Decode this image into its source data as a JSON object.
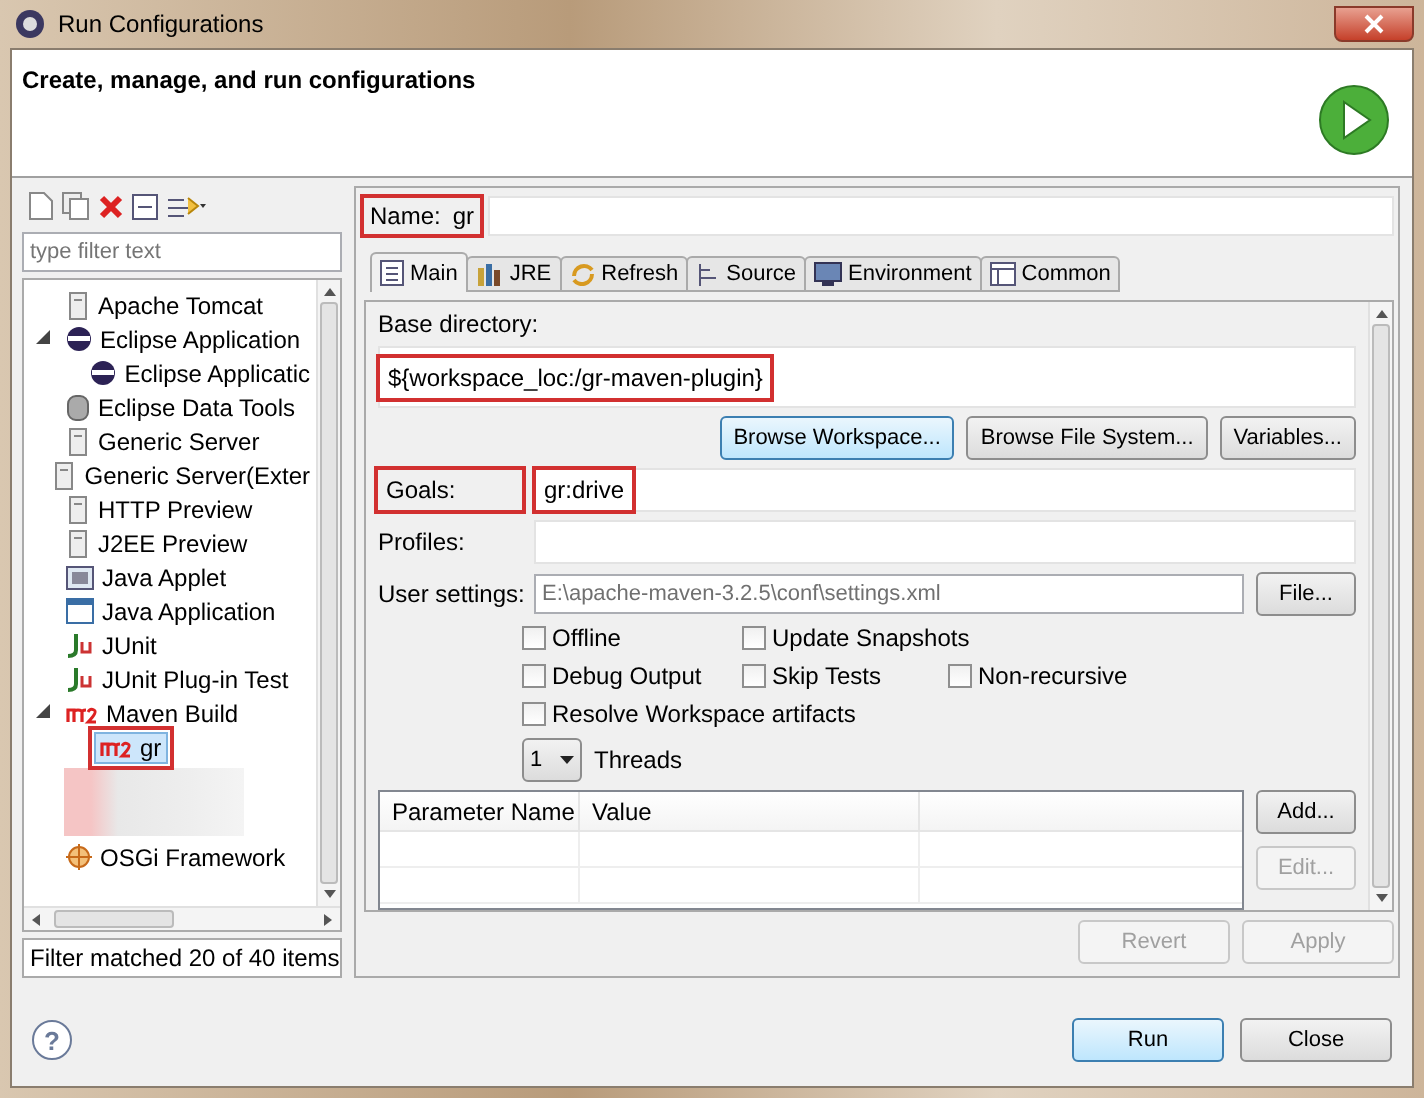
{
  "window": {
    "title": "Run Configurations"
  },
  "header": {
    "title": "Create, manage, and run configurations"
  },
  "sidebar": {
    "filter": {
      "placeholder": "type filter text"
    },
    "items": [
      {
        "label": "Apache Tomcat",
        "kind": "server",
        "selected": false
      },
      {
        "label": "Eclipse Application",
        "kind": "eclipse",
        "selected": false,
        "expanded": true,
        "children": [
          {
            "label": "Eclipse Applicatic",
            "kind": "eclipse",
            "selected": false
          }
        ]
      },
      {
        "label": "Eclipse Data Tools",
        "kind": "database",
        "selected": false
      },
      {
        "label": "Generic Server",
        "kind": "server",
        "selected": false
      },
      {
        "label": "Generic Server(Exter",
        "kind": "server",
        "selected": false
      },
      {
        "label": "HTTP Preview",
        "kind": "server",
        "selected": false
      },
      {
        "label": "J2EE Preview",
        "kind": "server",
        "selected": false
      },
      {
        "label": "Java Applet",
        "kind": "applet",
        "selected": false
      },
      {
        "label": "Java Application",
        "kind": "java",
        "selected": false
      },
      {
        "label": "JUnit",
        "kind": "junit",
        "selected": false
      },
      {
        "label": "JUnit Plug-in Test",
        "kind": "junit",
        "selected": false
      },
      {
        "label": "Maven Build",
        "kind": "maven",
        "selected": false,
        "expanded": true,
        "children": [
          {
            "label": "gr",
            "kind": "maven",
            "selected": true,
            "highlighted": true
          }
        ]
      },
      {
        "kind": "blurred"
      },
      {
        "label": "OSGi Framework",
        "kind": "osgi",
        "selected": false
      }
    ],
    "status": "Filter matched 20 of 40 items"
  },
  "name_field": {
    "label": "Name:",
    "value": "gr",
    "highlighted": true
  },
  "tabs": [
    {
      "label": "Main",
      "selected": true
    },
    {
      "label": "JRE",
      "selected": false
    },
    {
      "label": "Refresh",
      "selected": false
    },
    {
      "label": "Source",
      "selected": false
    },
    {
      "label": "Environment",
      "selected": false
    },
    {
      "label": "Common",
      "selected": false
    }
  ],
  "base_directory": {
    "label": "Base directory:",
    "value": "${workspace_loc:/gr-maven-plugin}",
    "highlighted": true
  },
  "directory_buttons": [
    {
      "label": "Browse Workspace...",
      "focused": true
    },
    {
      "label": "Browse File System...",
      "focused": false
    },
    {
      "label": "Variables...",
      "focused": false
    }
  ],
  "goals": {
    "label": "Goals:",
    "value": "gr:drive",
    "highlighted": true
  },
  "profiles": {
    "label": "Profiles:"
  },
  "user_settings": {
    "label": "User settings:",
    "value": "E:\\apache-maven-3.2.5\\conf\\settings.xml",
    "button": "File..."
  },
  "option_rows": [
    {
      "options": [
        {
          "label": "Offline",
          "checked": false
        },
        {
          "label": "Update Snapshots",
          "checked": false
        }
      ]
    },
    {
      "options": [
        {
          "label": "Debug Output",
          "checked": false
        },
        {
          "label": "Skip Tests",
          "checked": false
        },
        {
          "label": "Non-recursive",
          "checked": false
        }
      ]
    },
    {
      "options": [
        {
          "label": "Resolve Workspace artifacts",
          "checked": false
        }
      ]
    }
  ],
  "threads": {
    "value": "1",
    "label": "Threads"
  },
  "parameters": {
    "columns": [
      "Parameter Name",
      "Value"
    ],
    "buttons": [
      {
        "label": "Add...",
        "disabled": false
      },
      {
        "label": "Edit...",
        "disabled": true
      }
    ]
  },
  "panel_buttons": [
    {
      "label": "Revert",
      "disabled": true
    },
    {
      "label": "Apply",
      "disabled": true
    }
  ],
  "help": {
    "label": "?"
  },
  "dialog_buttons": [
    {
      "label": "Run",
      "default": true
    },
    {
      "label": "Close",
      "default": false
    }
  ]
}
